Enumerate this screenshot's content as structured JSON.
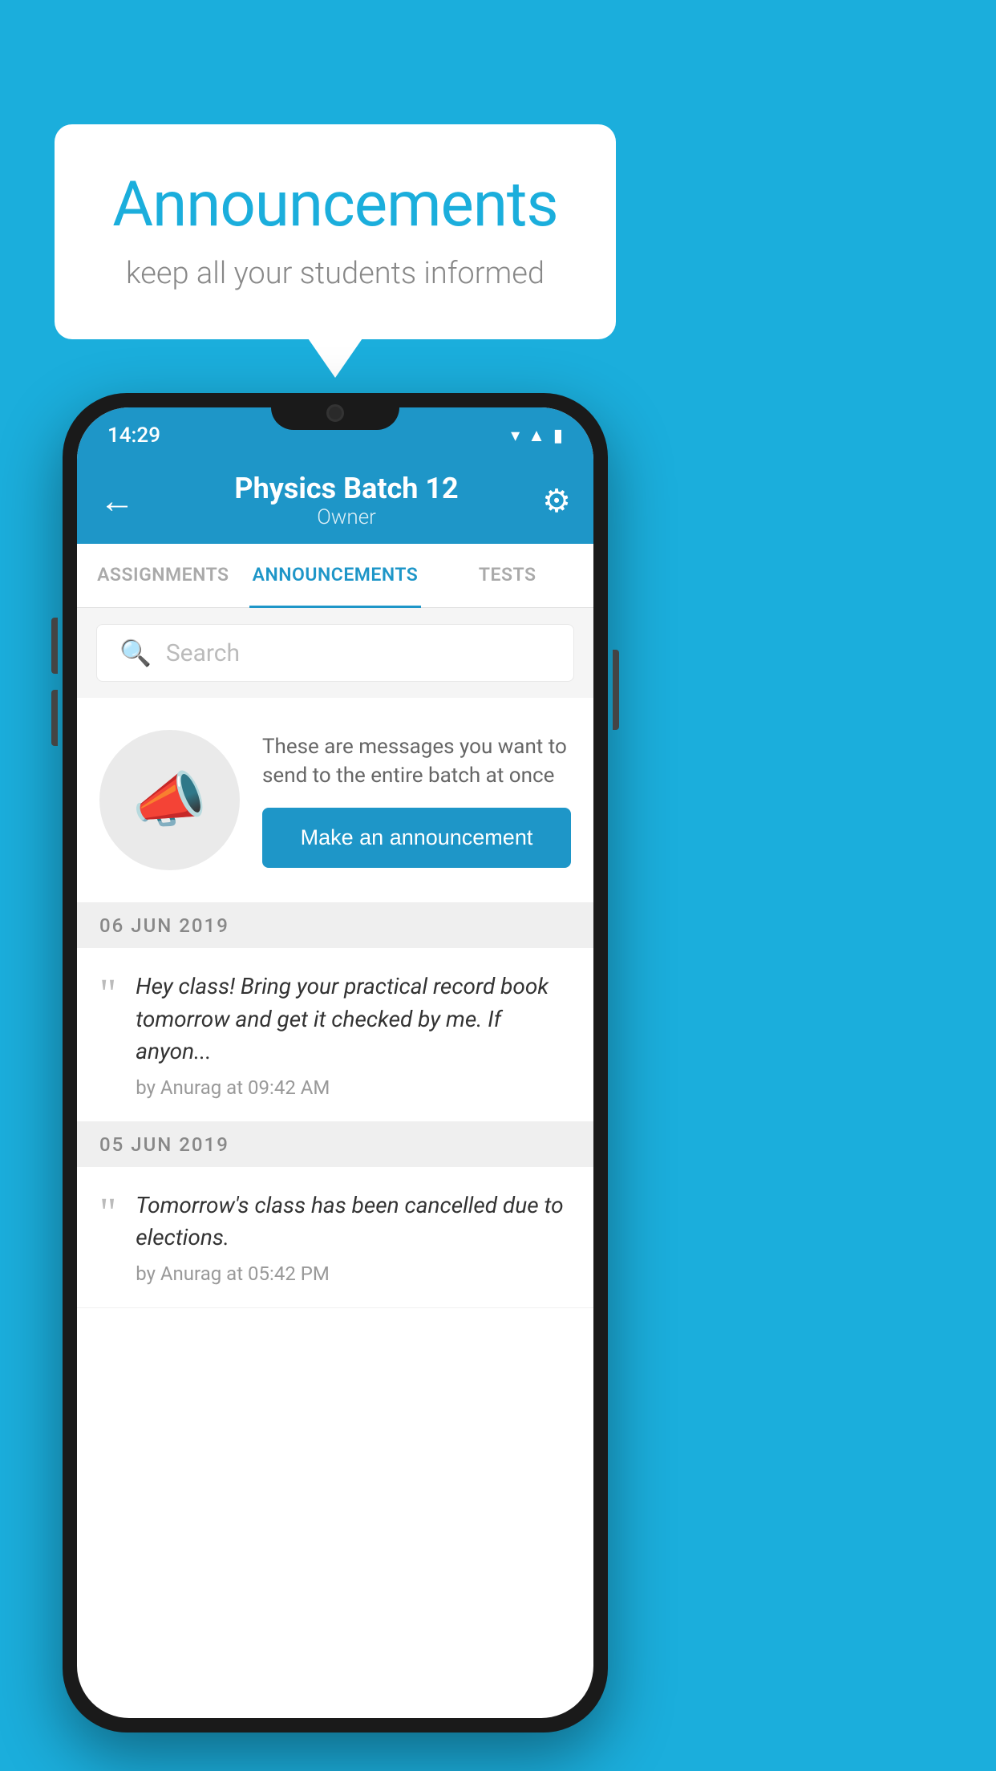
{
  "background": {
    "color": "#1BAEDC"
  },
  "speech_bubble": {
    "title": "Announcements",
    "subtitle": "keep all your students informed"
  },
  "phone": {
    "status_bar": {
      "time": "14:29",
      "icons": [
        "wifi",
        "signal",
        "battery"
      ]
    },
    "app_bar": {
      "back_label": "←",
      "batch_name": "Physics Batch 12",
      "batch_role": "Owner",
      "settings_icon": "⚙"
    },
    "tabs": [
      {
        "label": "ASSIGNMENTS",
        "active": false
      },
      {
        "label": "ANNOUNCEMENTS",
        "active": true
      },
      {
        "label": "TESTS",
        "active": false
      }
    ],
    "search": {
      "placeholder": "Search"
    },
    "promo": {
      "description": "These are messages you want to send to the entire batch at once",
      "button_label": "Make an announcement"
    },
    "announcements": [
      {
        "date": "06  JUN  2019",
        "text": "Hey class! Bring your practical record book tomorrow and get it checked by me. If anyon...",
        "meta": "by Anurag at 09:42 AM"
      },
      {
        "date": "05  JUN  2019",
        "text": "Tomorrow's class has been cancelled due to elections.",
        "meta": "by Anurag at 05:42 PM"
      }
    ]
  }
}
